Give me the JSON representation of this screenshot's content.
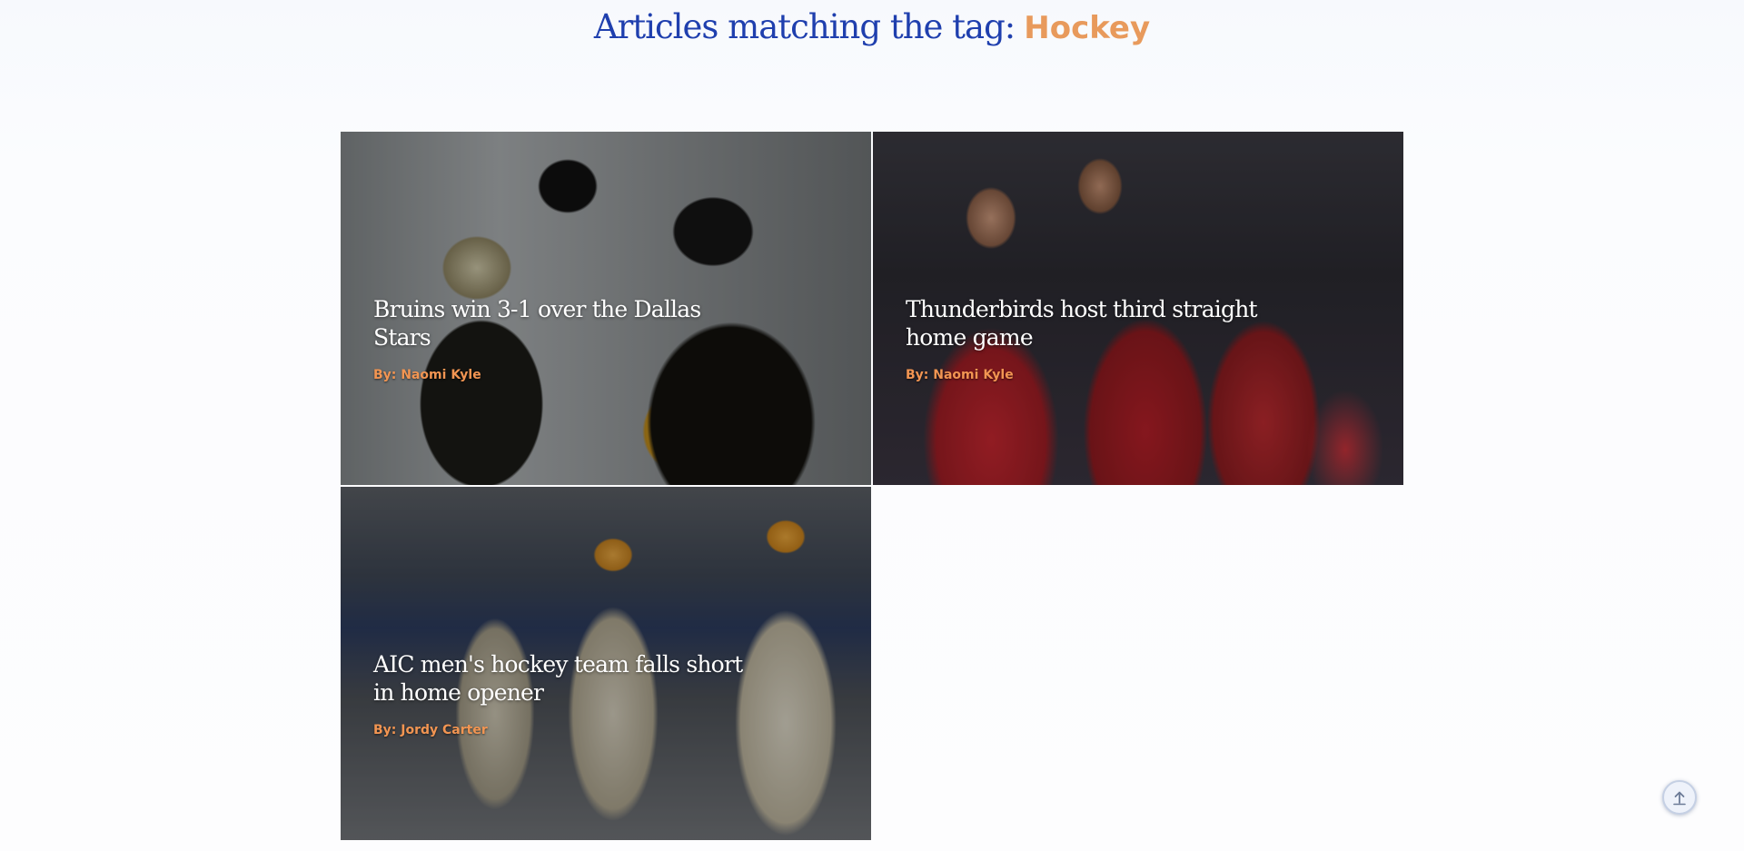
{
  "header": {
    "title_prefix": "Articles matching the tag:",
    "tag": "Hockey"
  },
  "articles": [
    {
      "title": "Bruins win 3-1 over the Dallas Stars",
      "author": "By: Naomi Kyle"
    },
    {
      "title": "Thunderbirds host third straight home game",
      "author": "By: Naomi Kyle"
    },
    {
      "title": "AIC men's hockey team falls short in home opener",
      "author": "By: Jordy Carter"
    }
  ],
  "icons": {
    "scroll_top": "arrow-up-icon"
  },
  "colors": {
    "title_blue": "#1f3fae",
    "tag_orange": "#e89a5c",
    "author_orange": "#f29552"
  }
}
